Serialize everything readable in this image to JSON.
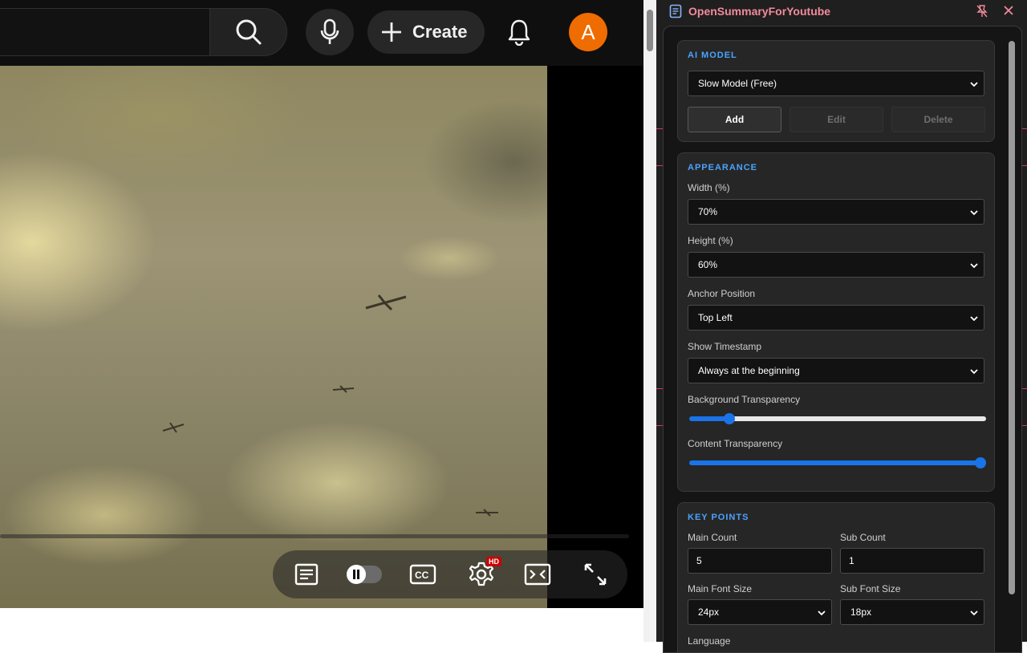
{
  "youtube": {
    "create_label": "Create",
    "avatar_letter": "A",
    "controls": {
      "hd_badge": "HD"
    }
  },
  "panel": {
    "title": "OpenSummaryForYoutube",
    "ai_model": {
      "section_title": "AI MODEL",
      "selected_model": "Slow Model (Free)",
      "add_label": "Add",
      "edit_label": "Edit",
      "delete_label": "Delete"
    },
    "appearance": {
      "section_title": "APPEARANCE",
      "width_label": "Width (%)",
      "width_value": "70%",
      "height_label": "Height (%)",
      "height_value": "60%",
      "anchor_label": "Anchor Position",
      "anchor_value": "Top Left",
      "timestamp_label": "Show Timestamp",
      "timestamp_value": "Always at the beginning",
      "bg_transparency_label": "Background Transparency",
      "bg_transparency_value": 0.12,
      "content_transparency_label": "Content Transparency",
      "content_transparency_value": 1.0
    },
    "key_points": {
      "section_title": "KEY POINTS",
      "main_count_label": "Main Count",
      "main_count_value": "5",
      "sub_count_label": "Sub Count",
      "sub_count_value": "1",
      "main_font_label": "Main Font Size",
      "main_font_value": "24px",
      "sub_font_label": "Sub Font Size",
      "sub_font_value": "18px",
      "language_label": "Language"
    }
  },
  "colors": {
    "accent_blue": "#4aa3ff",
    "slider_blue": "#1a73e8",
    "title_pink": "#f28b9b",
    "avatar_orange": "#ef6c00"
  }
}
